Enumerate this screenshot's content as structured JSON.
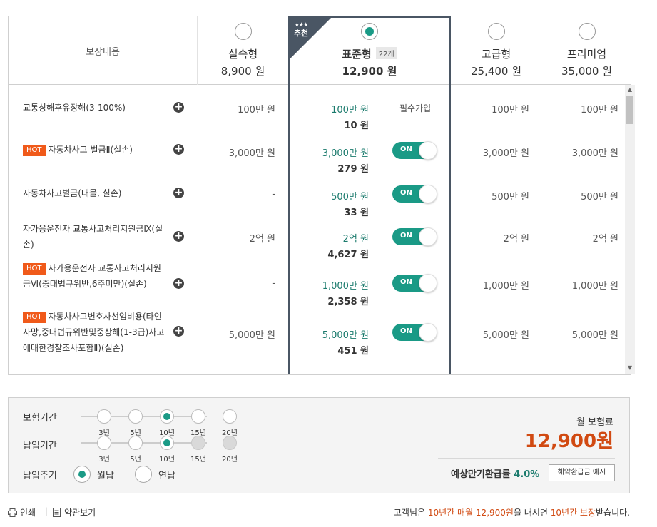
{
  "header": {
    "coverage_label": "보장내용",
    "plans": [
      {
        "name": "실속형",
        "price": "8,900 원",
        "selected": false
      },
      {
        "name": "표준형",
        "price": "12,900 원",
        "selected": true,
        "count": "22개",
        "badge": "추천",
        "stars": "★★★"
      },
      {
        "name": "고급형",
        "price": "25,400 원",
        "selected": false
      },
      {
        "name": "프리미엄",
        "price": "35,000 원",
        "selected": false
      }
    ]
  },
  "rows": [
    {
      "hot": "",
      "label": "교통상해후유장해(3-100%)",
      "basic": "100만 원",
      "std_amount": "100만 원",
      "std_price": "10 원",
      "std_control": "필수가입",
      "adv": "100만 원",
      "prem": "100만 원"
    },
    {
      "hot": "HOT",
      "label": "자동차사고 벌금Ⅱ(실손)",
      "basic": "3,000만 원",
      "std_amount": "3,000만 원",
      "std_price": "279 원",
      "std_control": "ON",
      "adv": "3,000만 원",
      "prem": "3,000만 원"
    },
    {
      "hot": "",
      "label": "자동차사고벌금(대물, 실손)",
      "basic": "-",
      "std_amount": "500만 원",
      "std_price": "33 원",
      "std_control": "ON",
      "adv": "500만 원",
      "prem": "500만 원"
    },
    {
      "hot": "",
      "label": "자가용운전자 교통사고처리지원금Ⅸ(실손)",
      "basic": "2억 원",
      "std_amount": "2억 원",
      "std_price": "4,627 원",
      "std_control": "ON",
      "adv": "2억 원",
      "prem": "2억 원"
    },
    {
      "hot": "HOT",
      "label": "자가용운전자 교통사고처리지원금Ⅵ(중대법규위반,6주미만)(실손)",
      "basic": "-",
      "std_amount": "1,000만 원",
      "std_price": "2,358 원",
      "std_control": "ON",
      "adv": "1,000만 원",
      "prem": "1,000만 원"
    },
    {
      "hot": "HOT",
      "label": "자동차사고변호사선임비용(타인사망,중대법규위반및중상해(1-3급)사고에대한경찰조사포함Ⅱ)(실손)",
      "basic": "5,000만 원",
      "std_amount": "5,000만 원",
      "std_price": "451 원",
      "std_control": "ON",
      "adv": "5,000만 원",
      "prem": "5,000만 원"
    }
  ],
  "panel": {
    "period_label": "보험기간",
    "payment_period_label": "납입기간",
    "cycle_label": "납입주기",
    "period_steps": [
      "3년",
      "5년",
      "10년",
      "15년",
      "20년"
    ],
    "period_selected": "10년",
    "payment_steps": [
      "3년",
      "5년",
      "10년",
      "15년",
      "20년"
    ],
    "payment_selected": "10년",
    "cycle_monthly": "월납",
    "cycle_yearly": "연납",
    "cycle_selected": "월납",
    "monthly_label": "월 보험료",
    "monthly_value": "12,900원",
    "refund_label": "예상만기환급률",
    "refund_rate": "4.0%",
    "refund_button": "해약환급금 예시"
  },
  "footer": {
    "print": "인쇄",
    "terms": "약관보기",
    "msg_prefix": "고객님은",
    "msg_h1": "10년간 매월 12,900원",
    "msg_mid": "을 내시면",
    "msg_h2": "10년간 보장",
    "msg_suffix": "받습니다."
  },
  "colors": {
    "accent": "#1a9a86",
    "hot": "#f05a1a",
    "price": "#d14a12",
    "ribbon": "#4a5664"
  }
}
